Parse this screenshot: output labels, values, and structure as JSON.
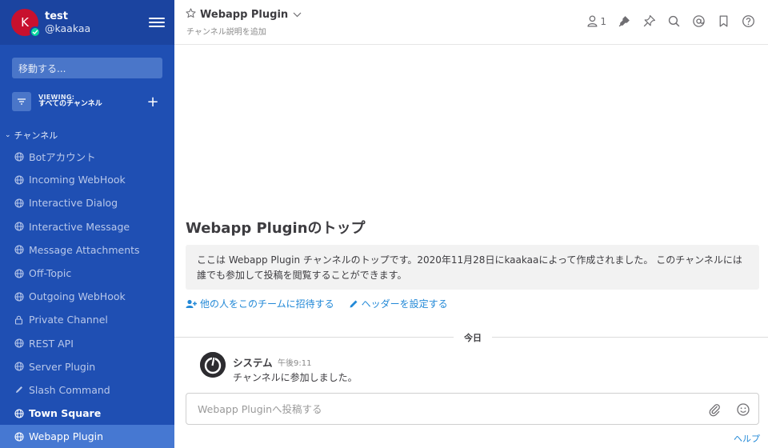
{
  "user": {
    "name": "test",
    "handle": "@kaakaa",
    "avatar_letter": "K",
    "status_color": "#06d6a0"
  },
  "sidebar": {
    "jump_placeholder": "移動する...",
    "viewing_label": "VIEWING:",
    "viewing_value": "すべてのチャンネル",
    "section_label": "チャンネル",
    "channels": [
      {
        "label": "Botアカウント",
        "icon": "globe-icon"
      },
      {
        "label": "Incoming WebHook",
        "icon": "globe-icon"
      },
      {
        "label": "Interactive Dialog",
        "icon": "globe-icon"
      },
      {
        "label": "Interactive Message",
        "icon": "globe-icon"
      },
      {
        "label": "Message Attachments",
        "icon": "globe-icon"
      },
      {
        "label": "Off-Topic",
        "icon": "globe-icon"
      },
      {
        "label": "Outgoing WebHook",
        "icon": "globe-icon"
      },
      {
        "label": "Private Channel",
        "icon": "lock-icon"
      },
      {
        "label": "REST API",
        "icon": "globe-icon"
      },
      {
        "label": "Server Plugin",
        "icon": "globe-icon"
      },
      {
        "label": "Slash Command",
        "icon": "pencil-icon"
      },
      {
        "label": "Town Square",
        "icon": "globe-icon"
      },
      {
        "label": "Webapp Plugin",
        "icon": "globe-icon"
      }
    ]
  },
  "header": {
    "channel_name": "Webapp Plugin",
    "description_placeholder": "チャンネル説明を追加",
    "member_count": "1"
  },
  "intro": {
    "title": "Webapp Pluginのトップ",
    "text": "ここは Webapp Plugin チャンネルのトップです。2020年11月28日にkaakaaによって作成されました。 このチャンネルには誰でも参加して投稿を閲覧することができます。",
    "invite_label": "他の人をこのチームに招待する",
    "header_label": "ヘッダーを設定する"
  },
  "date_separator": "今日",
  "post": {
    "author": "システム",
    "time": "午後9:11",
    "message": "チャンネルに参加しました。"
  },
  "composer": {
    "placeholder": "Webapp Pluginへ投稿する"
  },
  "help_label": "ヘルプ",
  "colors": {
    "sidebar_bg": "#1f4fb3",
    "sidebar_header_bg": "#1b44a0",
    "active_channel": "#4678d2",
    "link": "#2389d7",
    "avatar": "#c8102e"
  }
}
